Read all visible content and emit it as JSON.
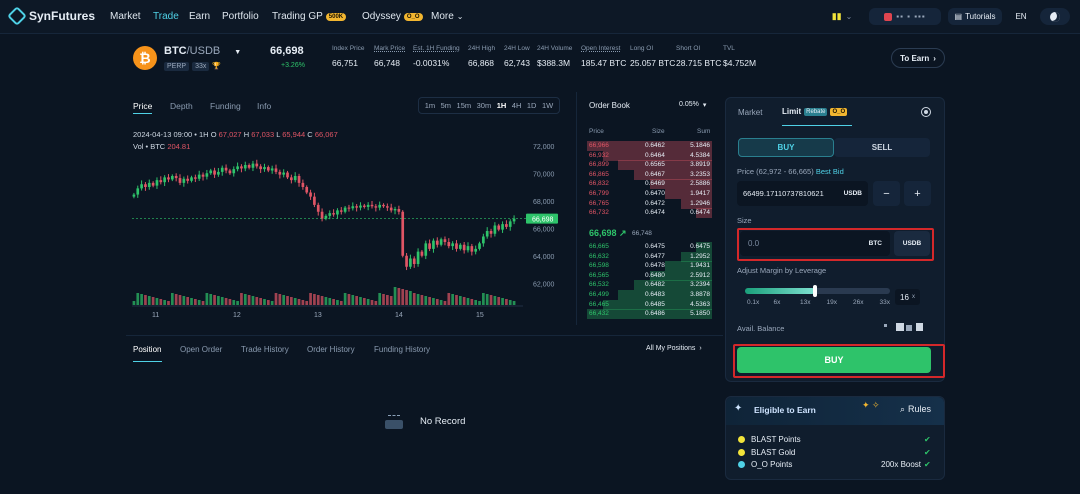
{
  "nav": {
    "brand": "SynFutures",
    "items": [
      {
        "label": "Market",
        "active": false
      },
      {
        "label": "Trade",
        "active": true
      },
      {
        "label": "Earn",
        "active": false
      },
      {
        "label": "Portfolio",
        "active": false
      },
      {
        "label": "Trading GP",
        "badge": "500K"
      },
      {
        "label": "Odyssey",
        "badge": "O_O"
      },
      {
        "label": "More"
      }
    ],
    "tutorials": "Tutorials",
    "lang": "EN"
  },
  "ticker": {
    "symbol": "BTC",
    "quote": "/USDB",
    "tag1": "PERP",
    "tag2": "33x",
    "price": "66,698",
    "change": "+3.26%",
    "stats": [
      {
        "label": "Index Price",
        "value": "66,751"
      },
      {
        "label": "Mark Price",
        "value": "66,748"
      },
      {
        "label": "Est. 1H Funding",
        "value": "-0.0031%"
      },
      {
        "label": "24H High",
        "value": "66,868"
      },
      {
        "label": "24H Low",
        "value": "62,743"
      },
      {
        "label": "24H Volume",
        "value": "$388.3M"
      },
      {
        "label": "Open Interest",
        "value": "185.47 BTC"
      },
      {
        "label": "Long OI",
        "value": "25.057 BTC"
      },
      {
        "label": "Short OI",
        "value": "28.715 BTC"
      },
      {
        "label": "TVL",
        "value": "$4.752M"
      }
    ],
    "to_earn": "To Earn"
  },
  "chart_tabs": [
    "Price",
    "Depth",
    "Funding",
    "Info"
  ],
  "intervals": [
    "1m",
    "5m",
    "15m",
    "30m",
    "1H",
    "4H",
    "1D",
    "1W"
  ],
  "chart_info": {
    "line1_prefix": "2024-04-13 09:00 • 1H",
    "o_label": "O",
    "o": "67,027",
    "h_label": "H",
    "h": "67,033",
    "l_label": "L",
    "l": "65,944",
    "c_label": "C",
    "c": "66,067",
    "vol_prefix": "Vol • BTC",
    "vol": "204.81"
  },
  "chart_data": {
    "type": "candlestick",
    "x_ticks": [
      "11",
      "12",
      "13",
      "14",
      "15"
    ],
    "y_ticks": [
      "72,000",
      "70,000",
      "68,000",
      "66,000",
      "64,000",
      "62,000"
    ],
    "ylim": [
      61000,
      73000
    ],
    "last_price": "66,698",
    "closes": [
      68450,
      68900,
      69200,
      69000,
      69300,
      69100,
      69500,
      69350,
      69700,
      69550,
      69800,
      69650,
      69300,
      69600,
      69450,
      69700,
      69600,
      69900,
      69750,
      70000,
      70200,
      69900,
      70100,
      70400,
      70200,
      70000,
      70300,
      70500,
      70350,
      70600,
      70400,
      70700,
      70500,
      70300,
      70450,
      70200,
      70350,
      70100,
      69900,
      70050,
      69700,
      69500,
      69800,
      69300,
      69000,
      68600,
      68300,
      67700,
      67200,
      66700,
      66900,
      67100,
      67000,
      67300,
      67200,
      67500,
      67450,
      67600,
      67500,
      67650,
      67550,
      67700,
      67600,
      67500,
      67700,
      67600,
      67500,
      67300,
      67400,
      67200,
      64000,
      63200,
      63800,
      63400,
      64300,
      64000,
      64900,
      64500,
      65100,
      64800,
      65200,
      65000,
      64700,
      64900,
      64500,
      64800,
      64400,
      64700,
      64300,
      64500,
      64900,
      65400,
      65800,
      65600,
      66200,
      65900,
      66300,
      66100,
      66500,
      66698
    ]
  },
  "orderbook": {
    "title": "Order Book",
    "precision": "0.05%",
    "cols": [
      "Price",
      "Size",
      "Sum"
    ],
    "asks": [
      [
        "66,966",
        "0.6462",
        "5.1846"
      ],
      [
        "66,932",
        "0.6464",
        "4.5384"
      ],
      [
        "66,899",
        "0.6565",
        "3.8919"
      ],
      [
        "66,865",
        "0.6467",
        "3.2353"
      ],
      [
        "66,832",
        "0.6469",
        "2.5886"
      ],
      [
        "66,799",
        "0.6470",
        "1.9417"
      ],
      [
        "66,765",
        "0.6472",
        "1.2946"
      ],
      [
        "66,732",
        "0.6474",
        "0.6474"
      ]
    ],
    "mid": "66,698",
    "mid_mark": "66,748",
    "bids": [
      [
        "66,665",
        "0.6475",
        "0.6475"
      ],
      [
        "66,632",
        "0.6477",
        "1.2952"
      ],
      [
        "66,598",
        "0.6478",
        "1.9431"
      ],
      [
        "66,565",
        "0.6480",
        "2.5912"
      ],
      [
        "66,532",
        "0.6482",
        "3.2394"
      ],
      [
        "66,499",
        "0.6483",
        "3.8878"
      ],
      [
        "66,465",
        "0.6485",
        "4.5363"
      ],
      [
        "66,432",
        "0.6486",
        "5.1850"
      ]
    ]
  },
  "positions": {
    "tabs": [
      "Position",
      "Open Order",
      "Trade History",
      "Order History",
      "Funding History"
    ],
    "all": "All My Positions",
    "empty": "No Record"
  },
  "trade": {
    "tabs": [
      "Market",
      "Limit"
    ],
    "limit_badges": [
      "Rebate",
      "O_O"
    ],
    "buy": "BUY",
    "sell": "SELL",
    "price_label_prefix": "Price (62,972 - 66,665)",
    "best_bid": "Best Bid",
    "price_value": "66499.17110737810621",
    "price_unit": "USDB",
    "size_label": "Size",
    "size_placeholder": "0.0",
    "size_btc": "BTC",
    "size_usdb": "USDB",
    "leverage_label": "Adjust Margin by Leverage",
    "leverage_marks": [
      "0.1x",
      "6x",
      "13x",
      "19x",
      "26x",
      "33x"
    ],
    "leverage_value": "16",
    "leverage_fraction": 0.48,
    "balance_label": "Avail. Balance",
    "buy_button": "BUY"
  },
  "earn": {
    "title": "Eligible to Earn",
    "rules": "Rules",
    "items": [
      {
        "label": "BLAST Points",
        "extra": ""
      },
      {
        "label": "BLAST Gold",
        "extra": ""
      },
      {
        "label": "O_O Points",
        "extra": "200x Boost"
      }
    ]
  },
  "colors": {
    "accent": "#4fd1e6",
    "up": "#2ec36a",
    "down": "#e05565",
    "bg": "#0b1522"
  }
}
